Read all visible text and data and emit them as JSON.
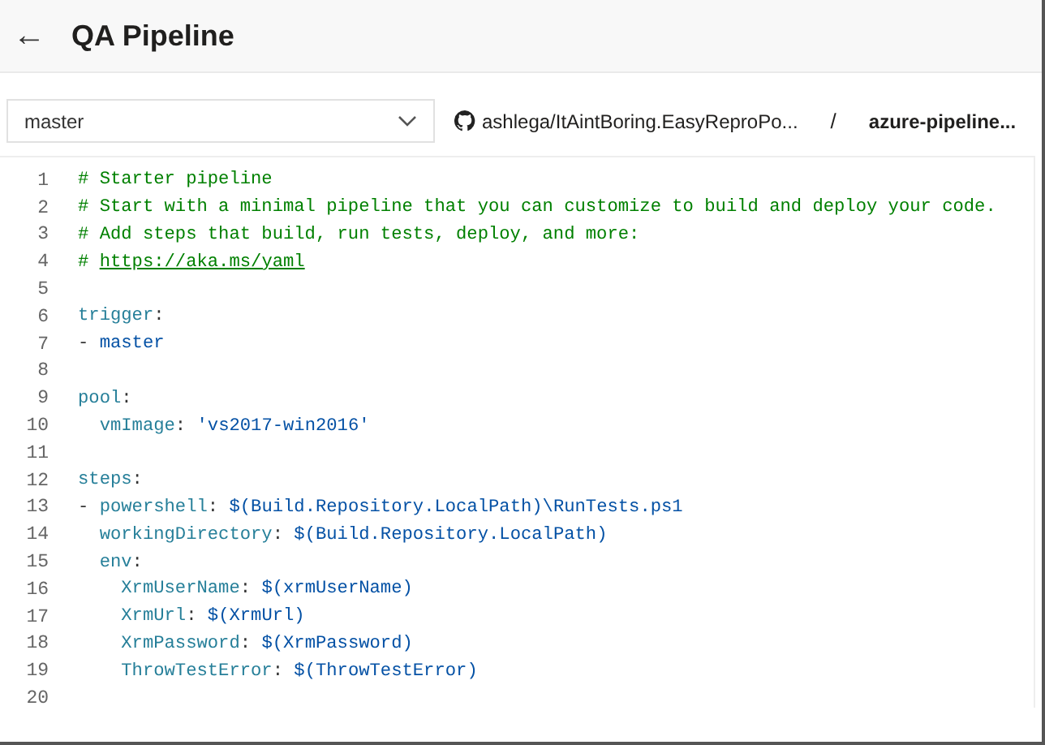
{
  "header": {
    "back_icon": "←",
    "title": "QA Pipeline"
  },
  "toolbar": {
    "branch": "master",
    "repository": "ashlega/ItAintBoring.EasyReproPo...",
    "separator": "/",
    "file": "azure-pipeline..."
  },
  "editor": {
    "lines": [
      {
        "number": "1",
        "tokens": [
          {
            "kind": "comment",
            "text": "# Starter pipeline"
          }
        ]
      },
      {
        "number": "2",
        "tokens": [
          {
            "kind": "comment",
            "text": "# Start with a minimal pipeline that you can customize to build and deploy your code."
          }
        ]
      },
      {
        "number": "3",
        "tokens": [
          {
            "kind": "comment",
            "text": "# Add steps that build, run tests, deploy, and more:"
          }
        ]
      },
      {
        "number": "4",
        "tokens": [
          {
            "kind": "comment",
            "text": "# "
          },
          {
            "kind": "link",
            "text": "https://aka.ms/yaml"
          }
        ]
      },
      {
        "number": "5"
      },
      {
        "number": "6",
        "tokens": [
          {
            "kind": "key",
            "text": "trigger"
          },
          {
            "kind": "punct",
            "text": ":"
          }
        ]
      },
      {
        "number": "7",
        "tokens": [
          {
            "kind": "punct",
            "text": "- "
          },
          {
            "kind": "value",
            "text": "master"
          }
        ]
      },
      {
        "number": "8"
      },
      {
        "number": "9",
        "tokens": [
          {
            "kind": "key",
            "text": "pool"
          },
          {
            "kind": "punct",
            "text": ":"
          }
        ]
      },
      {
        "number": "10",
        "tokens": [
          {
            "kind": "key",
            "text": "  vmImage"
          },
          {
            "kind": "punct",
            "text": ": "
          },
          {
            "kind": "value",
            "text": "'vs2017-win2016'"
          }
        ]
      },
      {
        "number": "11"
      },
      {
        "number": "12",
        "tokens": [
          {
            "kind": "key",
            "text": "steps"
          },
          {
            "kind": "punct",
            "text": ":"
          }
        ]
      },
      {
        "number": "13",
        "tokens": [
          {
            "kind": "punct",
            "text": "- "
          },
          {
            "kind": "key",
            "text": "powershell"
          },
          {
            "kind": "punct",
            "text": ": "
          },
          {
            "kind": "value",
            "text": "$(Build.Repository.LocalPath)\\RunTests.ps1"
          }
        ]
      },
      {
        "number": "14",
        "tokens": [
          {
            "kind": "key",
            "text": "  workingDirectory"
          },
          {
            "kind": "punct",
            "text": ": "
          },
          {
            "kind": "value",
            "text": "$(Build.Repository.LocalPath)"
          }
        ]
      },
      {
        "number": "15",
        "tokens": [
          {
            "kind": "key",
            "text": "  env"
          },
          {
            "kind": "punct",
            "text": ":"
          }
        ]
      },
      {
        "number": "16",
        "tokens": [
          {
            "kind": "key",
            "text": "    XrmUserName"
          },
          {
            "kind": "punct",
            "text": ": "
          },
          {
            "kind": "value",
            "text": "$(xrmUserName)"
          }
        ]
      },
      {
        "number": "17",
        "tokens": [
          {
            "kind": "key",
            "text": "    XrmUrl"
          },
          {
            "kind": "punct",
            "text": ": "
          },
          {
            "kind": "value",
            "text": "$(XrmUrl)"
          }
        ]
      },
      {
        "number": "18",
        "tokens": [
          {
            "kind": "key",
            "text": "    XrmPassword"
          },
          {
            "kind": "punct",
            "text": ": "
          },
          {
            "kind": "value",
            "text": "$(XrmPassword)"
          }
        ]
      },
      {
        "number": "19",
        "tokens": [
          {
            "kind": "key",
            "text": "    ThrowTestError"
          },
          {
            "kind": "punct",
            "text": ": "
          },
          {
            "kind": "value",
            "text": "$(ThrowTestError)"
          }
        ]
      },
      {
        "number": "20"
      }
    ]
  }
}
